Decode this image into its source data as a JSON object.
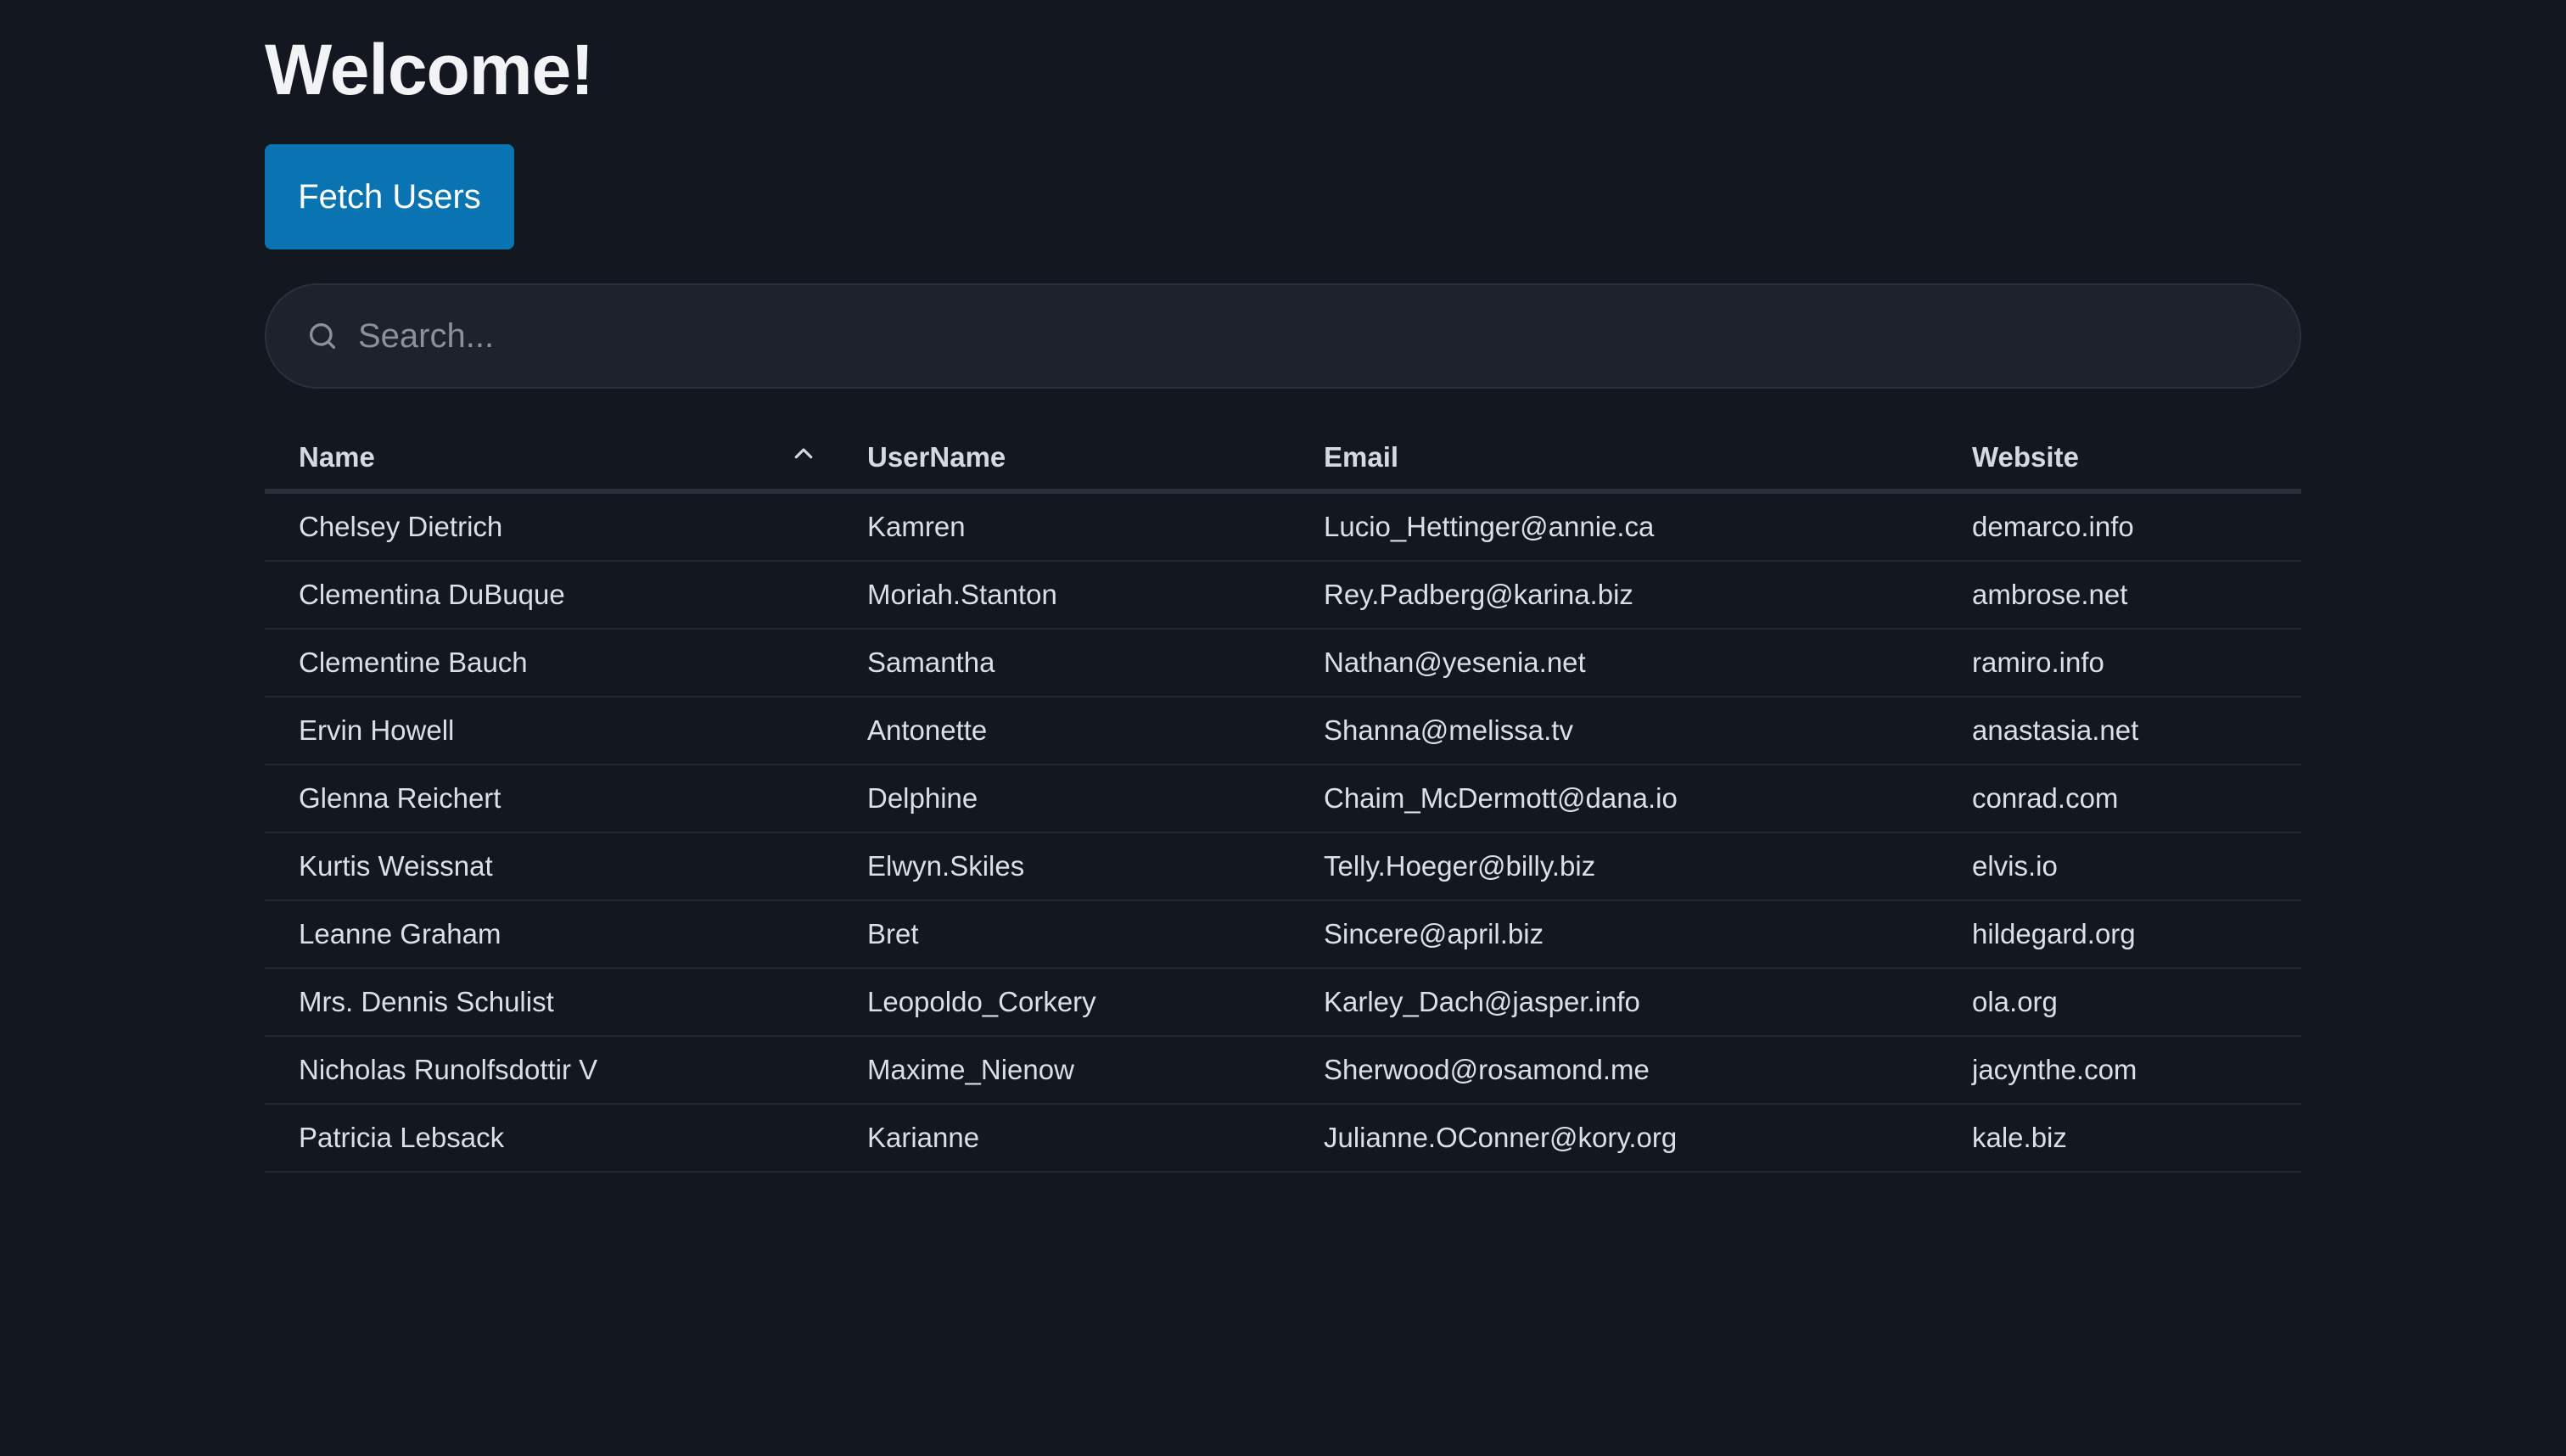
{
  "page": {
    "title": "Welcome!",
    "fetch_button": "Fetch Users"
  },
  "search": {
    "icon": "search-icon",
    "placeholder": "Search..."
  },
  "table": {
    "columns": [
      "Name",
      "UserName",
      "Email",
      "Website"
    ],
    "sort": {
      "column": "Name",
      "direction": "ascending",
      "icon": "chevron-up-icon"
    },
    "rows": [
      [
        "Chelsey Dietrich",
        "Kamren",
        "Lucio_Hettinger@annie.ca",
        "demarco.info"
      ],
      [
        "Clementina DuBuque",
        "Moriah.Stanton",
        "Rey.Padberg@karina.biz",
        "ambrose.net"
      ],
      [
        "Clementine Bauch",
        "Samantha",
        "Nathan@yesenia.net",
        "ramiro.info"
      ],
      [
        "Ervin Howell",
        "Antonette",
        "Shanna@melissa.tv",
        "anastasia.net"
      ],
      [
        "Glenna Reichert",
        "Delphine",
        "Chaim_McDermott@dana.io",
        "conrad.com"
      ],
      [
        "Kurtis Weissnat",
        "Elwyn.Skiles",
        "Telly.Hoeger@billy.biz",
        "elvis.io"
      ],
      [
        "Leanne Graham",
        "Bret",
        "Sincere@april.biz",
        "hildegard.org"
      ],
      [
        "Mrs. Dennis Schulist",
        "Leopoldo_Corkery",
        "Karley_Dach@jasper.info",
        "ola.org"
      ],
      [
        "Nicholas Runolfsdottir V",
        "Maxime_Nienow",
        "Sherwood@rosamond.me",
        "jacynthe.com"
      ],
      [
        "Patricia Lebsack",
        "Karianne",
        "Julianne.OConner@kory.org",
        "kale.biz"
      ]
    ]
  },
  "colors": {
    "background": "#131720",
    "accent": "#0a74b3",
    "search_bg": "#1e222d"
  }
}
